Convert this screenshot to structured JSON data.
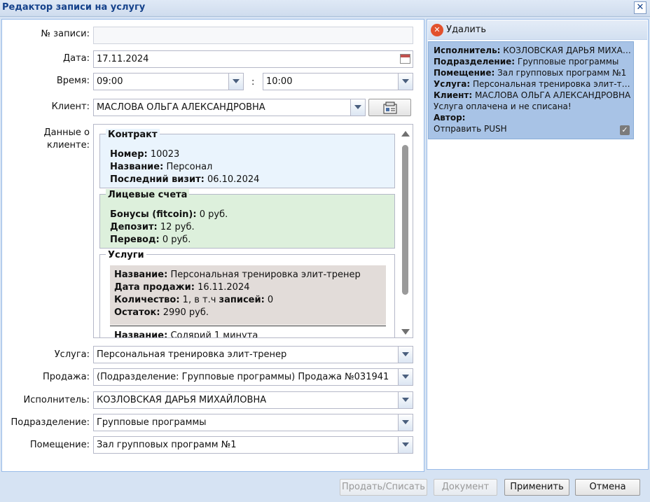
{
  "window": {
    "title": "Редактор записи на услугу",
    "close_icon": "close-icon"
  },
  "form": {
    "record_no": {
      "label": "№ записи:",
      "value": ""
    },
    "date": {
      "label": "Дата:",
      "value": "17.11.2024"
    },
    "time": {
      "label": "Время:",
      "from": "09:00",
      "sep": ":",
      "to": "10:00"
    },
    "client": {
      "label": "Клиент:",
      "value": "МАСЛОВА  ОЛЬГА АЛЕКСАНДРОВНА"
    },
    "client_data_label_1": "Данные о",
    "client_data_label_2": "клиенте:",
    "service": {
      "label": "Услуга:",
      "value": "Персональная тренировка элит-тренер"
    },
    "sale": {
      "label": "Продажа:",
      "value": "(Подразделение: Групповые программы) Продажа №031941"
    },
    "executor": {
      "label": "Исполнитель:",
      "value": "КОЗЛОВСКАЯ  ДАРЬЯ МИХАЙЛОВНА"
    },
    "department": {
      "label": "Подразделение:",
      "value": "Групповые программы"
    },
    "room": {
      "label": "Помещение:",
      "value": "Зал групповых программ №1"
    }
  },
  "client_info": {
    "contract": {
      "legend": "Контракт",
      "number_label": "Номер:",
      "number": "10023",
      "name_label": "Название:",
      "name": "Персонал",
      "last_visit_label": "Последний визит:",
      "last_visit": "06.10.2024"
    },
    "accounts": {
      "legend": "Лицевые счета",
      "bonus_label": "Бонусы (fitcoin):",
      "bonus": "0 руб.",
      "deposit_label": "Депозит:",
      "deposit": "12 руб.",
      "transfer_label": "Перевод:",
      "transfer": "0 руб."
    },
    "services": {
      "legend": "Услуги",
      "items": [
        {
          "name_label": "Название:",
          "name": "Персональная тренировка элит-тренер",
          "sale_date_label": "Дата продажи:",
          "sale_date": "16.11.2024",
          "qty_label": "Количество:",
          "qty": "1, в т.ч",
          "records_label": "записей:",
          "records": "0",
          "rest_label": "Остаток:",
          "rest": "2990 руб."
        },
        {
          "name_label": "Название:",
          "name": "Солярий 1 минута"
        }
      ]
    }
  },
  "record_panel": {
    "delete_label": "Удалить",
    "executor_label": "Исполнитель:",
    "executor": "КОЗЛОВСКАЯ ДАРЬЯ МИХАЙЛОВНА",
    "department_label": "Подразделение:",
    "department": "Групповые программы",
    "room_label": "Помещение:",
    "room": "Зал групповых программ №1",
    "service_label": "Услуга:",
    "service": "Персональная тренировка элит-тренер",
    "client_label": "Клиент:",
    "client": "МАСЛОВА ОЛЬГА АЛЕКСАНДРОВНА",
    "status": "Услуга оплачена и не списана!",
    "author_label": "Автор:",
    "push_label": "Отправить PUSH",
    "push_checked": true
  },
  "buttons": {
    "sell": "Продать/Списать",
    "document": "Документ",
    "apply": "Применить",
    "cancel": "Отмена"
  }
}
